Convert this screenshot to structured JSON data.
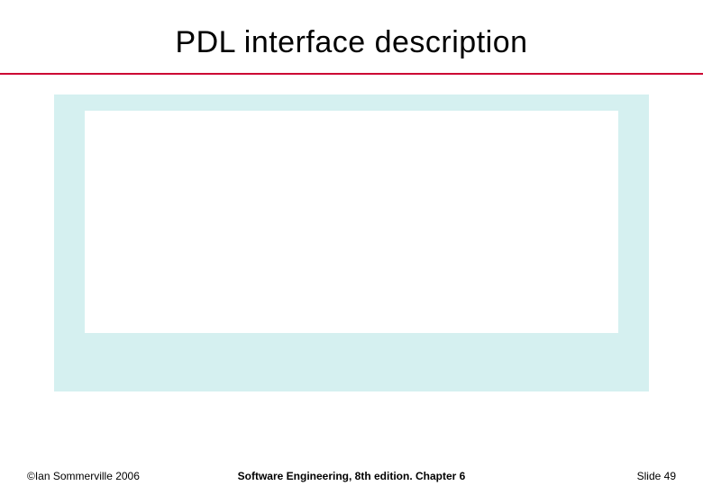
{
  "slide": {
    "title": "PDL interface description"
  },
  "footer": {
    "copyright": "©Ian Sommerville 2006",
    "center": "Software Engineering, 8th edition. Chapter 6",
    "page_label": "Slide ",
    "page_number": "49"
  }
}
